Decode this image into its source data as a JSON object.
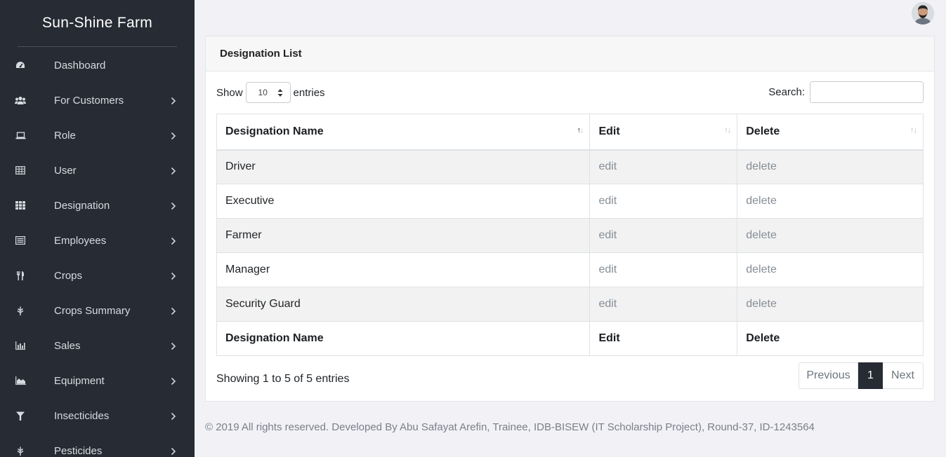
{
  "sidebar": {
    "brand": "Sun-Shine Farm",
    "items": [
      {
        "label": "Dashboard",
        "icon": "dashboard-icon",
        "has_submenu": false
      },
      {
        "label": "For Customers",
        "icon": "users-icon",
        "has_submenu": true
      },
      {
        "label": "Role",
        "icon": "laptop-icon",
        "has_submenu": true
      },
      {
        "label": "User",
        "icon": "table-icon",
        "has_submenu": true
      },
      {
        "label": "Designation",
        "icon": "grid-icon",
        "has_submenu": true
      },
      {
        "label": "Employees",
        "icon": "id-card-icon",
        "has_submenu": true
      },
      {
        "label": "Crops",
        "icon": "utensils-icon",
        "has_submenu": true
      },
      {
        "label": "Crops Summary",
        "icon": "leaf-icon",
        "has_submenu": true
      },
      {
        "label": "Sales",
        "icon": "bar-chart-icon",
        "has_submenu": true
      },
      {
        "label": "Equipment",
        "icon": "area-chart-icon",
        "has_submenu": true
      },
      {
        "label": "Insecticides",
        "icon": "filter-icon",
        "has_submenu": true
      },
      {
        "label": "Pesticides",
        "icon": "leaf-icon",
        "has_submenu": true
      }
    ]
  },
  "card": {
    "title": "Designation List"
  },
  "controls": {
    "show_label": "Show",
    "entries_value": "10",
    "entries_label": "entries",
    "search_label": "Search:",
    "search_value": ""
  },
  "table": {
    "columns": [
      "Designation Name",
      "Edit",
      "Delete"
    ],
    "rows": [
      [
        "Driver",
        "edit",
        "delete"
      ],
      [
        "Executive",
        "edit",
        "delete"
      ],
      [
        "Farmer",
        "edit",
        "delete"
      ],
      [
        "Manager",
        "edit",
        "delete"
      ],
      [
        "Security Guard",
        "edit",
        "delete"
      ]
    ]
  },
  "info": "Showing 1 to 5 of 5 entries",
  "pager": {
    "previous": "Previous",
    "current": "1",
    "next": "Next"
  },
  "footer": "© 2019 All rights reserved. Developed By Abu Safayat Arefin, Trainee, IDB-BISEW (IT Scholarship Project), Round-37, ID-1243564",
  "colors": {
    "sidebar_bg": "#272b34",
    "page_bg": "#f1f1f6",
    "accent": "#272b34"
  }
}
